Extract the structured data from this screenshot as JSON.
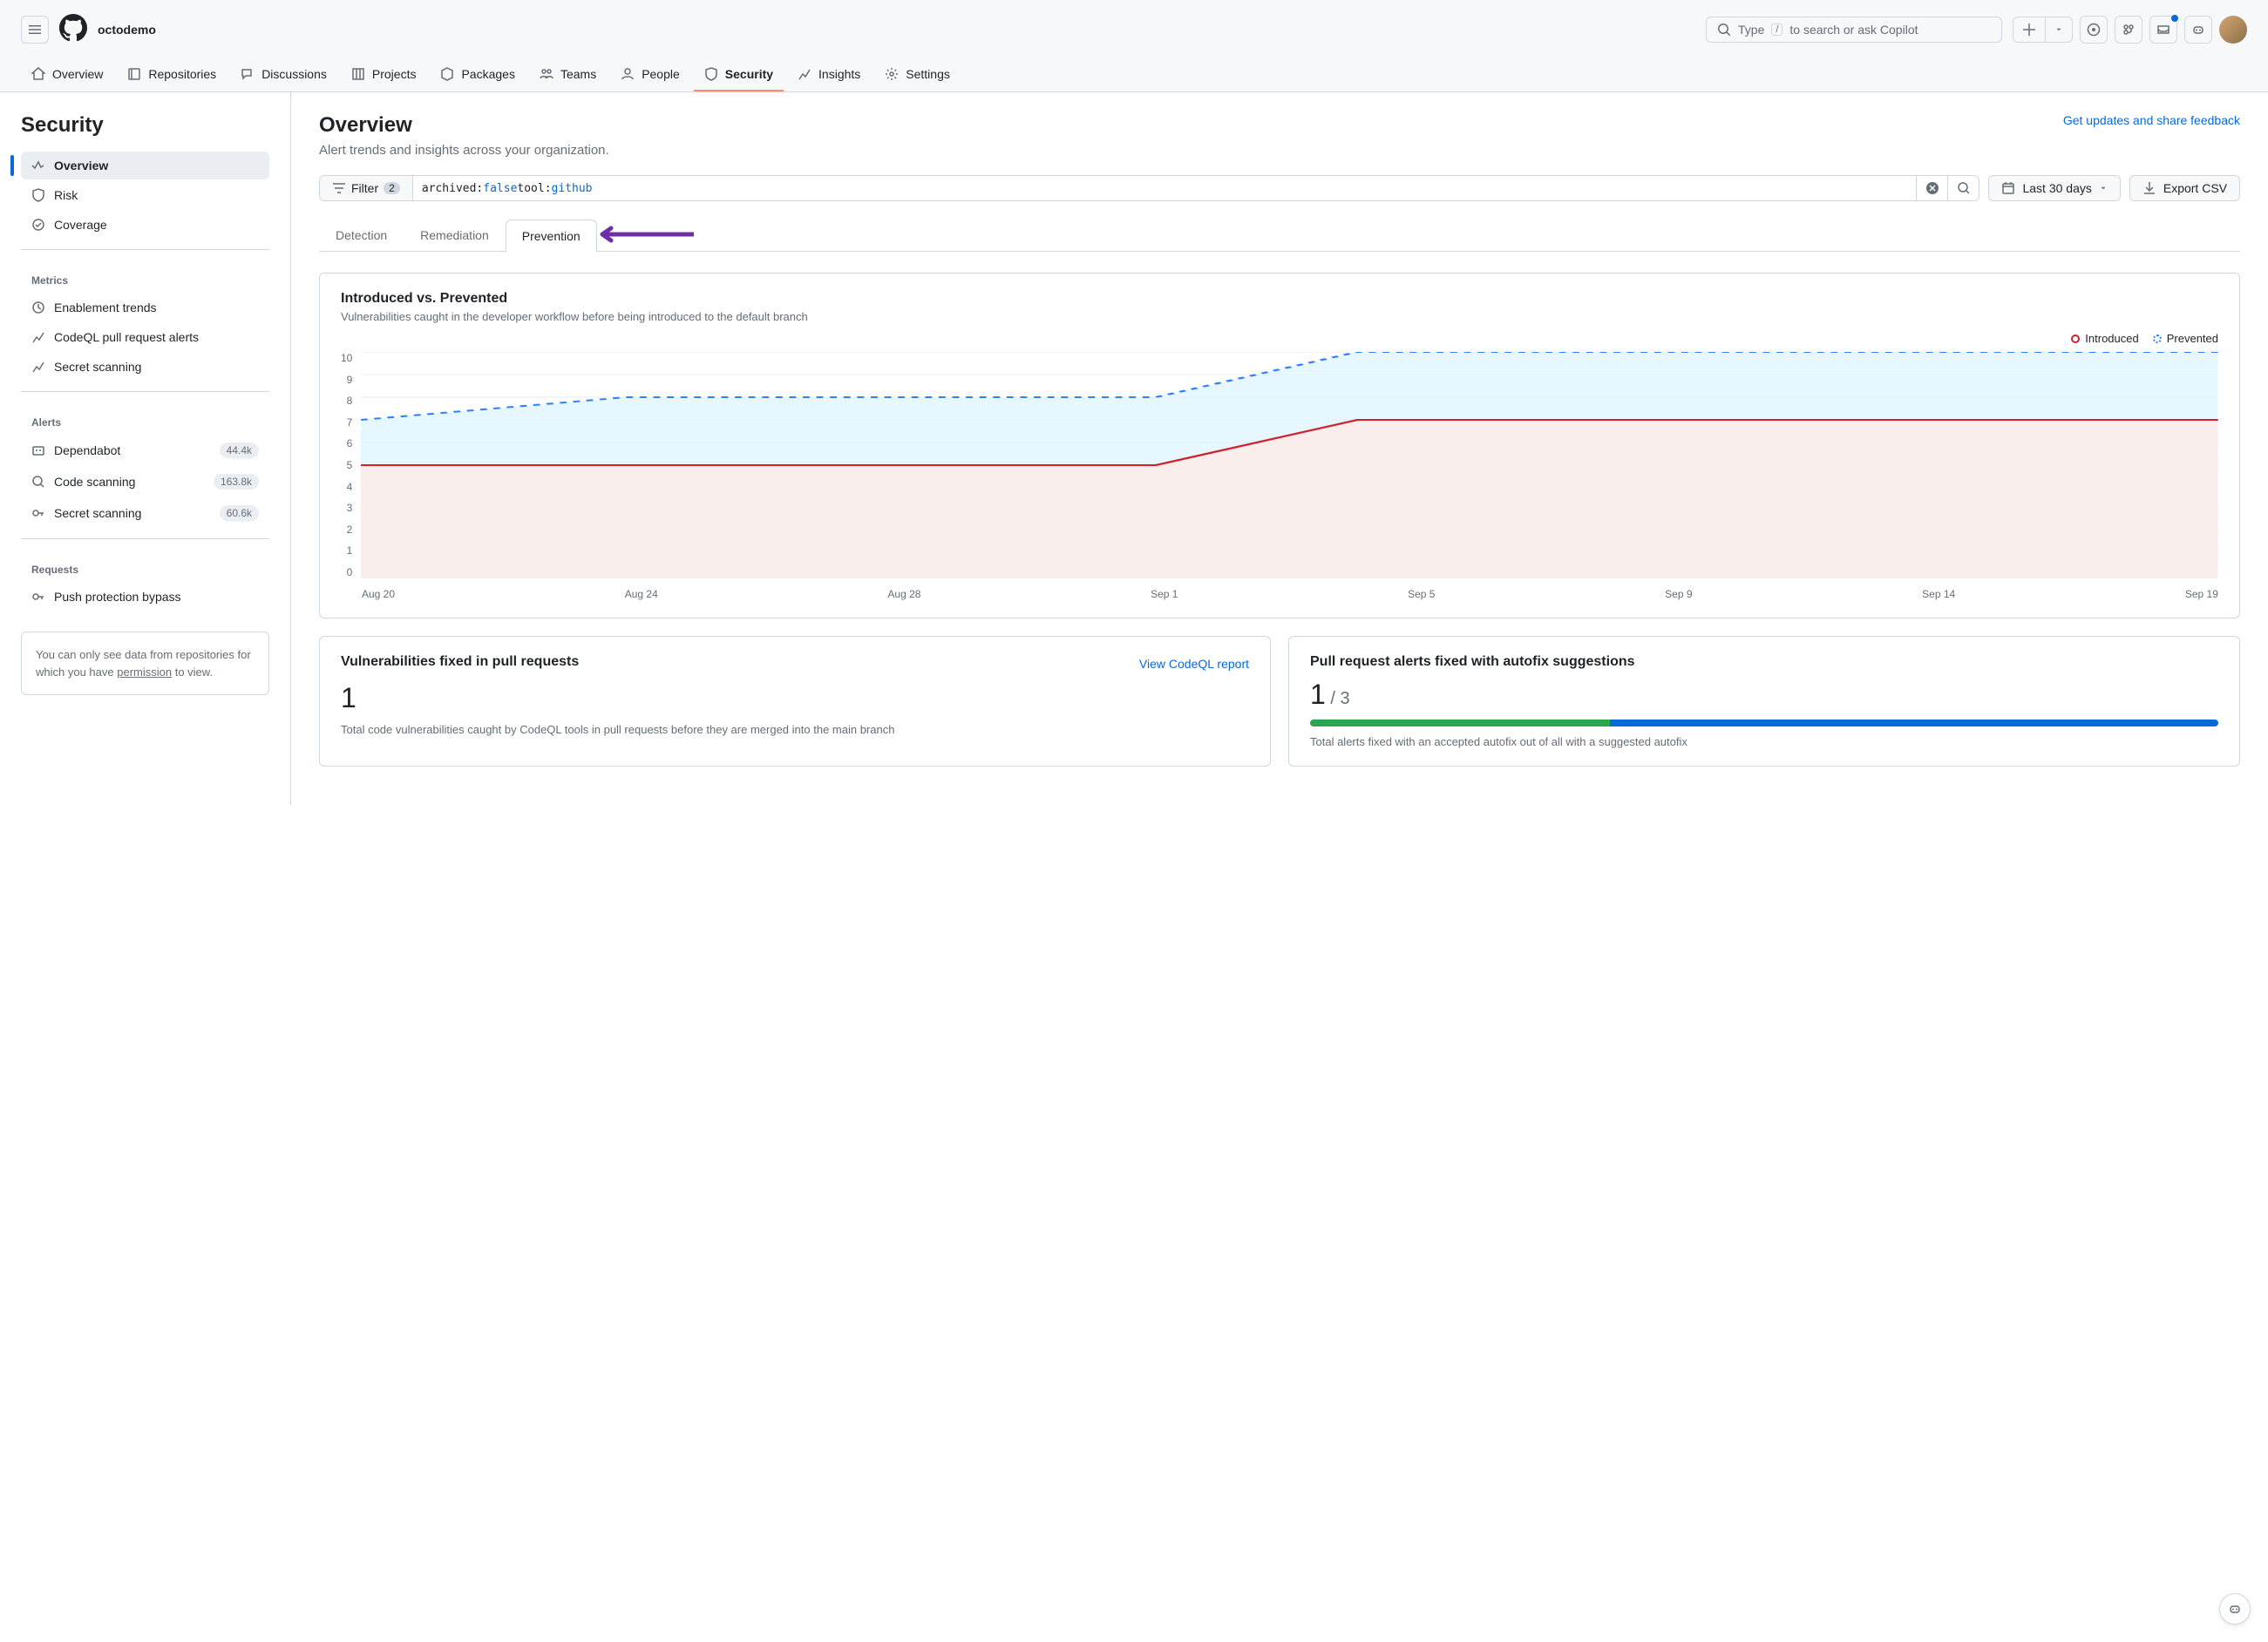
{
  "org": "octodemo",
  "search_placeholder": "Type",
  "search_suffix": "to search or ask Copilot",
  "search_key": "/",
  "nav": [
    "Overview",
    "Repositories",
    "Discussions",
    "Projects",
    "Packages",
    "Teams",
    "People",
    "Security",
    "Insights",
    "Settings"
  ],
  "sidebar": {
    "title": "Security",
    "main": [
      {
        "label": "Overview"
      },
      {
        "label": "Risk"
      },
      {
        "label": "Coverage"
      }
    ],
    "metrics_header": "Metrics",
    "metrics": [
      {
        "label": "Enablement trends"
      },
      {
        "label": "CodeQL pull request alerts"
      },
      {
        "label": "Secret scanning"
      }
    ],
    "alerts_header": "Alerts",
    "alerts": [
      {
        "label": "Dependabot",
        "count": "44.4k"
      },
      {
        "label": "Code scanning",
        "count": "163.8k"
      },
      {
        "label": "Secret scanning",
        "count": "60.6k"
      }
    ],
    "requests_header": "Requests",
    "requests": [
      {
        "label": "Push protection bypass"
      }
    ],
    "note_pre": "You can only see data from repositories for which you have ",
    "note_link": "permission",
    "note_post": " to view."
  },
  "page": {
    "title": "Overview",
    "subtitle": "Alert trends and insights across your organization.",
    "feedback": "Get updates and share feedback"
  },
  "filter": {
    "label": "Filter",
    "count": "2",
    "query": {
      "k1": "archived:",
      "v1": "false",
      "k2": " tool:",
      "v2": "github"
    },
    "date": "Last 30 days",
    "export": "Export CSV"
  },
  "tabs": [
    "Detection",
    "Remediation",
    "Prevention"
  ],
  "chart_card": {
    "title": "Introduced vs. Prevented",
    "subtitle": "Vulnerabilities caught in the developer workflow before being introduced to the default branch",
    "legend_introduced": "Introduced",
    "legend_prevented": "Prevented"
  },
  "chart_data": {
    "type": "area",
    "title": "Introduced vs. Prevented",
    "xlabel": "",
    "ylabel": "",
    "ylim": [
      0,
      10
    ],
    "y_ticks": [
      10,
      9,
      8,
      7,
      6,
      5,
      4,
      3,
      2,
      1,
      0
    ],
    "x_ticks": [
      "Aug 20",
      "Aug 24",
      "Aug 28",
      "Sep 1",
      "Sep 5",
      "Sep 9",
      "Sep 14",
      "Sep 19"
    ],
    "series": [
      {
        "name": "Prevented",
        "color": "#2f81f7",
        "style": "dotted",
        "values_at_xticks": [
          7,
          8,
          8,
          8,
          10,
          10,
          10,
          10
        ]
      },
      {
        "name": "Introduced",
        "color": "#cf222e",
        "style": "solid",
        "values_at_xticks": [
          5,
          5,
          5,
          5,
          7,
          7,
          7,
          7
        ]
      }
    ]
  },
  "vuln_card": {
    "title": "Vulnerabilities fixed in pull requests",
    "link": "View CodeQL report",
    "value": "1",
    "desc": "Total code vulnerabilities caught by CodeQL tools in pull requests before they are merged into the main branch"
  },
  "autofix_card": {
    "title": "Pull request alerts fixed with autofix suggestions",
    "value": "1",
    "denom": " / 3",
    "desc": "Total alerts fixed with an accepted autofix out of all with a suggested autofix"
  }
}
